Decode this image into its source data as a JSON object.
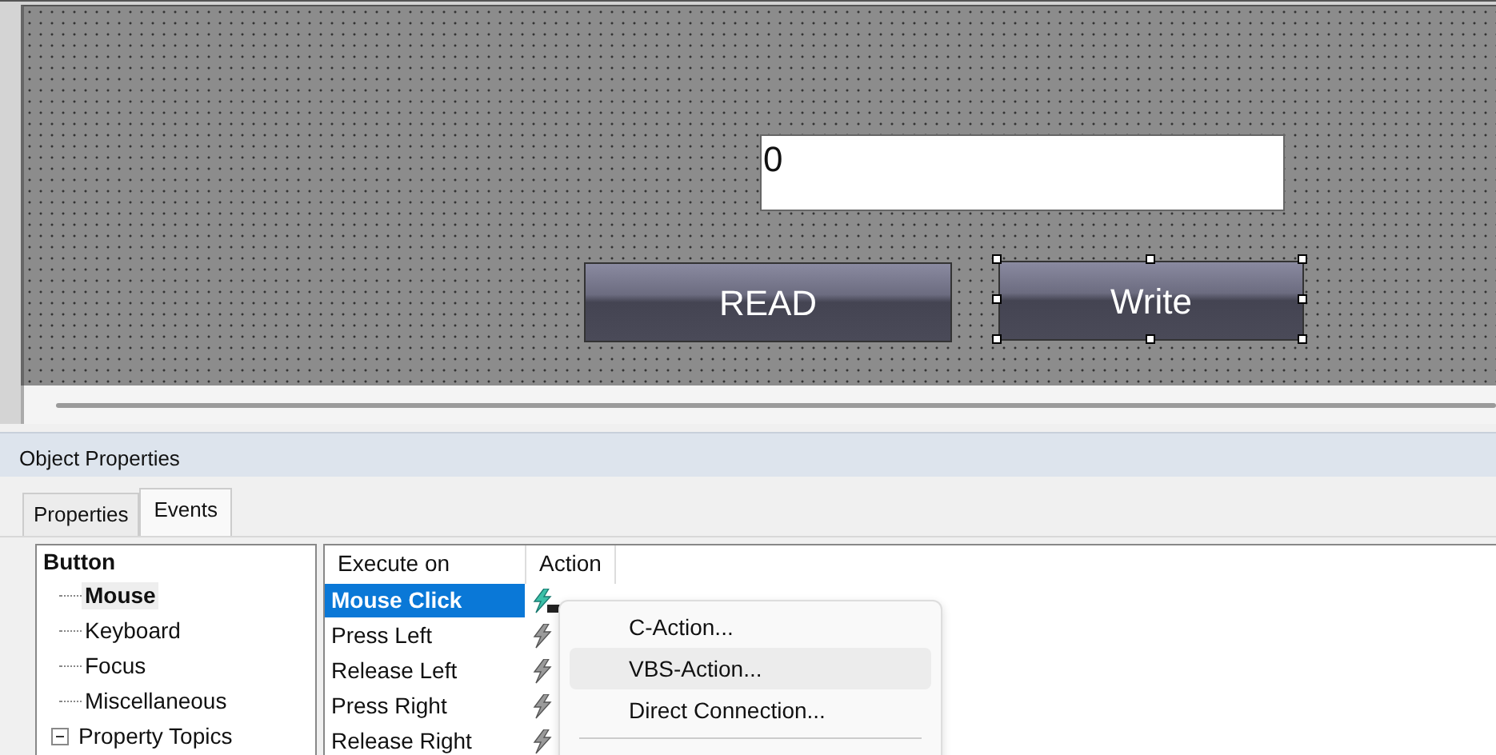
{
  "canvas": {
    "objects": [
      {
        "kind": "field",
        "value": "0",
        "selected": false
      },
      {
        "kind": "button",
        "label": "READ",
        "selected": false
      },
      {
        "kind": "button",
        "label": "Write",
        "selected": true
      }
    ]
  },
  "panel": {
    "title": "Object Properties",
    "tabs": [
      {
        "label": "Properties",
        "selected": false
      },
      {
        "label": "Events",
        "selected": true
      }
    ],
    "tree": {
      "label": "Button",
      "children": [
        {
          "label": "Mouse",
          "selected": true
        },
        {
          "label": "Keyboard",
          "selected": false
        },
        {
          "label": "Focus",
          "selected": false
        },
        {
          "label": "Miscellaneous",
          "selected": false
        },
        {
          "label": "Property Topics",
          "selected": false,
          "expanded": true
        }
      ]
    },
    "events": {
      "columns": [
        "Execute on",
        "Action"
      ],
      "rows": [
        {
          "label": "Mouse Click",
          "selected": true,
          "has_vbs_action": true
        },
        {
          "label": "Press Left",
          "selected": false,
          "has_vbs_action": false
        },
        {
          "label": "Release Left",
          "selected": false,
          "has_vbs_action": false
        },
        {
          "label": "Press Right",
          "selected": false,
          "has_vbs_action": false
        },
        {
          "label": "Release Right",
          "selected": false,
          "has_vbs_action": false
        }
      ]
    },
    "context_menu": {
      "items": [
        {
          "label": "C-Action...",
          "highlighted": false
        },
        {
          "label": "VBS-Action...",
          "highlighted": true
        },
        {
          "label": "Direct Connection...",
          "highlighted": false
        }
      ]
    }
  }
}
